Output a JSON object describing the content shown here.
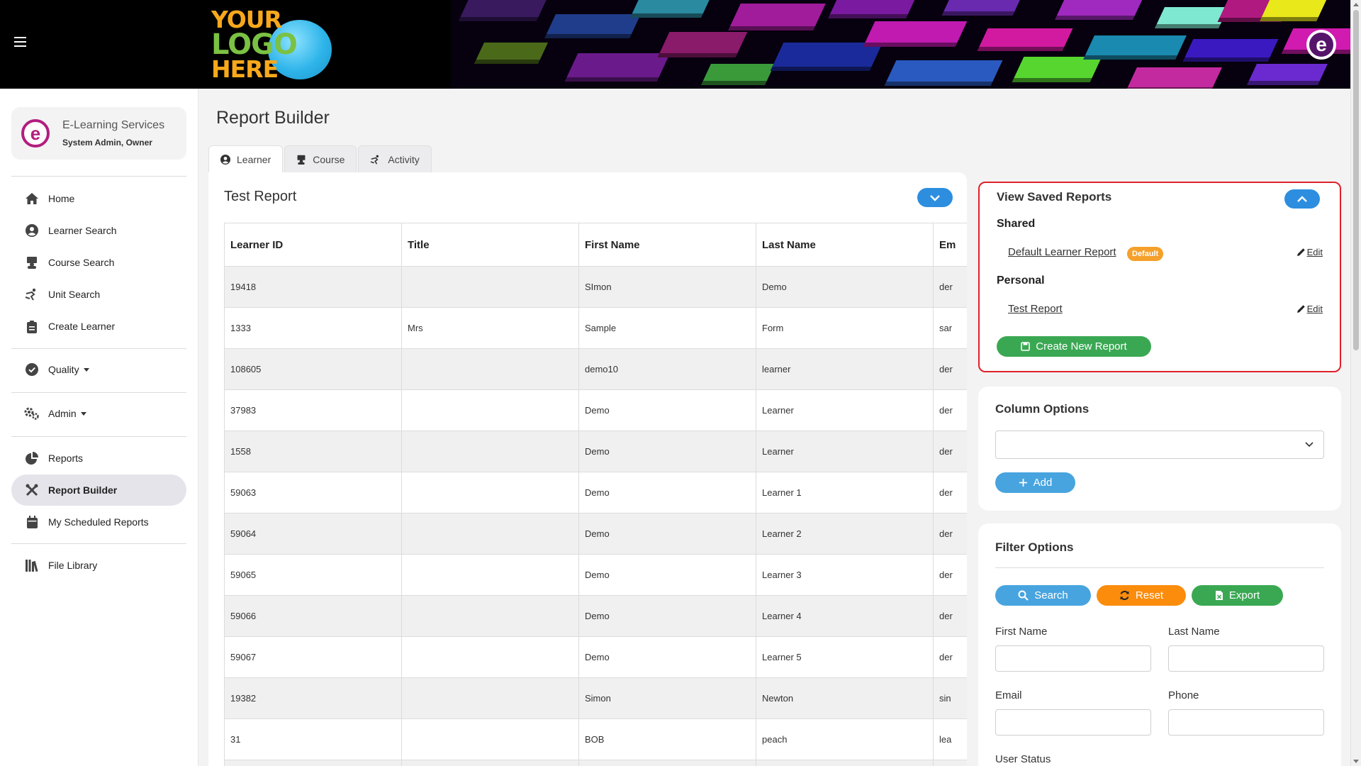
{
  "header": {
    "menu_icon": "hamburger-icon",
    "logo_lines": [
      "YOUR",
      "LOGO",
      "HERE"
    ],
    "corner_logo": "e"
  },
  "sidebar": {
    "org_logo": "e",
    "org_name": "E-Learning Services",
    "org_role": "System Admin, Owner",
    "items": [
      {
        "label": "Home",
        "icon": "home-icon"
      },
      {
        "label": "Learner Search",
        "icon": "user-circle-icon"
      },
      {
        "label": "Course Search",
        "icon": "course-icon"
      },
      {
        "label": "Unit Search",
        "icon": "unit-icon"
      },
      {
        "label": "Create Learner",
        "icon": "clipboard-icon"
      },
      {
        "label": "Quality",
        "icon": "check-circle-icon"
      },
      {
        "label": "Admin",
        "icon": "gears-icon"
      },
      {
        "label": "Reports",
        "icon": "pie-chart-icon"
      },
      {
        "label": "Report Builder",
        "icon": "tools-icon"
      },
      {
        "label": "My Scheduled Reports",
        "icon": "calendar-icon"
      },
      {
        "label": "File Library",
        "icon": "library-icon"
      }
    ]
  },
  "main": {
    "page_title": "Report Builder",
    "tabs": [
      {
        "label": "Learner",
        "icon": "user-circle-icon",
        "active": true
      },
      {
        "label": "Course",
        "icon": "course-icon",
        "active": false
      },
      {
        "label": "Activity",
        "icon": "activity-icon",
        "active": false
      }
    ],
    "report": {
      "title": "Test Report",
      "columns": [
        "Learner ID",
        "Title",
        "First Name",
        "Last Name",
        "Em"
      ],
      "rows": [
        [
          "19418",
          "",
          "SImon",
          "Demo",
          "der"
        ],
        [
          "1333",
          "Mrs",
          "Sample",
          "Form",
          "sar"
        ],
        [
          "108605",
          "",
          "demo10",
          "learner",
          "der"
        ],
        [
          "37983",
          "",
          "Demo",
          "Learner",
          "der"
        ],
        [
          "1558",
          "",
          "Demo",
          "Learner",
          "der"
        ],
        [
          "59063",
          "",
          "Demo",
          "Learner 1",
          "der"
        ],
        [
          "59064",
          "",
          "Demo",
          "Learner 2",
          "der"
        ],
        [
          "59065",
          "",
          "Demo",
          "Learner 3",
          "der"
        ],
        [
          "59066",
          "",
          "Demo",
          "Learner 4",
          "der"
        ],
        [
          "59067",
          "",
          "Demo",
          "Learner 5",
          "der"
        ],
        [
          "19382",
          "",
          "Simon",
          "Newton",
          "sin"
        ],
        [
          "31",
          "",
          "BOB",
          "peach",
          "lea"
        ],
        [
          "",
          "",
          "",
          "",
          ""
        ]
      ]
    }
  },
  "saved_reports": {
    "title": "View Saved Reports",
    "shared_heading": "Shared",
    "shared": [
      {
        "name": "Default Learner Report",
        "badge": "Default",
        "edit": "Edit"
      }
    ],
    "personal_heading": "Personal",
    "personal": [
      {
        "name": "Test Report",
        "edit": "Edit"
      }
    ],
    "create_label": "Create New Report"
  },
  "column_options": {
    "title": "Column Options",
    "select_value": "",
    "add_label": "Add"
  },
  "filter_options": {
    "title": "Filter Options",
    "search_label": "Search",
    "reset_label": "Reset",
    "export_label": "Export",
    "fields": {
      "first_name": "First Name",
      "last_name": "Last Name",
      "email": "Email",
      "phone": "Phone",
      "user_status": "User Status"
    }
  },
  "colors": {
    "accent_blue": "#2d8ee0",
    "search_blue": "#48a4df",
    "reset_orange": "#fb8c0c",
    "export_green": "#3aa853",
    "badge_orange": "#f5a02b",
    "highlight_red": "#e0202a",
    "brand_purple": "#b21e7e"
  }
}
